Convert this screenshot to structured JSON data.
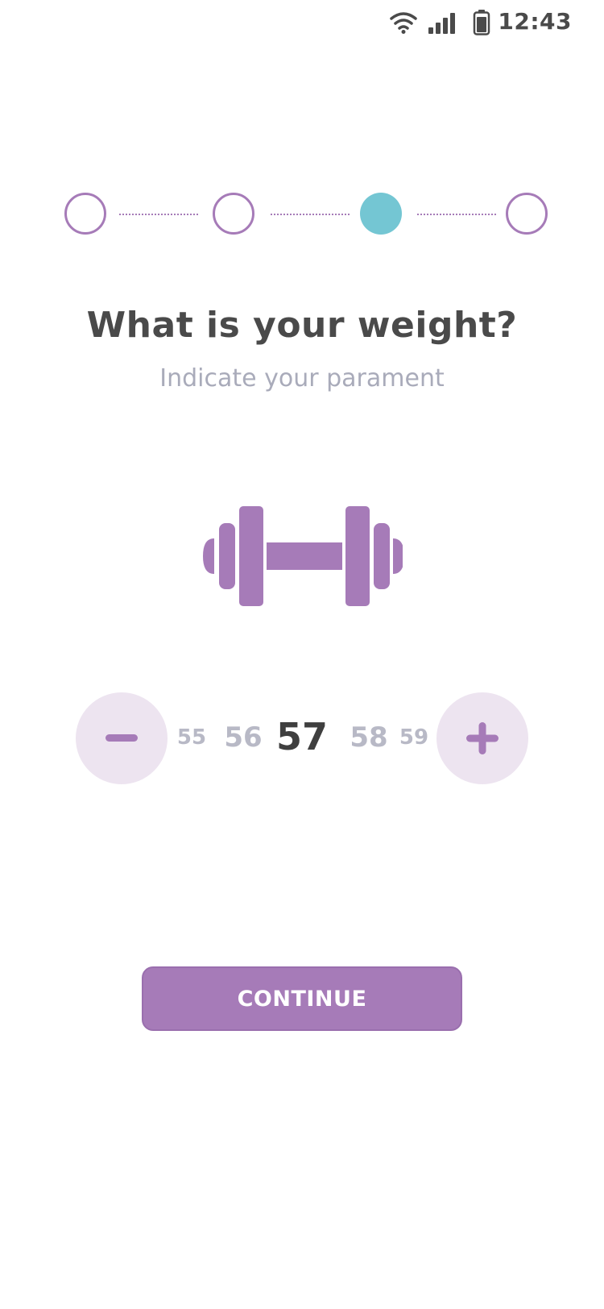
{
  "status_bar": {
    "time": "12:43",
    "icons": [
      "wifi-icon",
      "signal-icon",
      "battery-icon"
    ]
  },
  "stepper": {
    "total_steps": 4,
    "current_step": 3
  },
  "header": {
    "title": "What is your weight?",
    "subtitle": "Indicate your parament"
  },
  "illustration": {
    "icon": "dumbbell-icon"
  },
  "weight_picker": {
    "values": [
      "55",
      "56",
      "57",
      "58",
      "59"
    ],
    "selected": "57",
    "decrement_icon": "minus-icon",
    "increment_icon": "plus-icon"
  },
  "actions": {
    "continue_label": "CONTINUE"
  },
  "colors": {
    "accent": "#a67bb8",
    "accent_light": "#ede4f0",
    "active_step": "#74c6d3",
    "title_text": "#4a4a4a",
    "muted_text": "#a9abba"
  }
}
